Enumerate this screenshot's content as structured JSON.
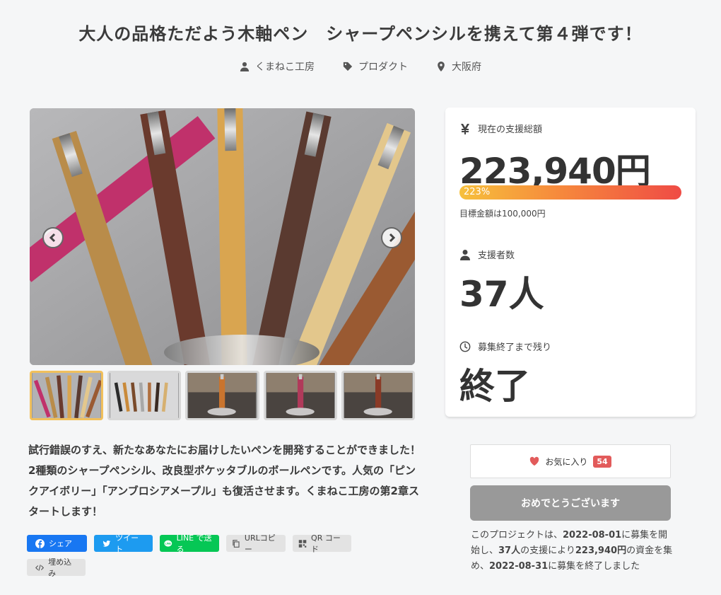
{
  "project": {
    "title": "大人の品格ただよう木軸ペン　シャープペンシルを携えて第４弾です！",
    "meta": [
      {
        "icon": "user-icon",
        "label": "くまねこ工房"
      },
      {
        "icon": "tag-icon",
        "label": "プロダクト"
      },
      {
        "icon": "location-pin-icon",
        "label": "大阪府"
      }
    ]
  },
  "stats": {
    "amount_label": "現在の支援総額",
    "amount_value": "223,940円",
    "progress_text": "223%",
    "progress_percent": 223,
    "goal_text": "目標金額は100,000円",
    "backers_label": "支援者数",
    "backers_value": "37人",
    "remaining_label": "募集終了まで残り",
    "remaining_value": "終了"
  },
  "description": "試行錯誤のすえ、新たなあなたにお届けしたいペンを開発することができました！2種類のシャープペンシル、改良型ポケッタブルのボールペンです。人気の「ピンクアイボリー」「アンブロシアメープル」も復活させます。くまねこ工房の第2章スタートします！",
  "share": {
    "facebook": "シェア",
    "twitter": "ツイート",
    "line": "LINE で送る",
    "url_copy": "URLコピー",
    "qr": "QR コード",
    "embed": "埋め込み"
  },
  "favorite": {
    "label": "お気に入り",
    "count": "54"
  },
  "status_button": "おめでとうございます",
  "summary": {
    "prefix": "このプロジェクトは、",
    "start_date": "2022-08-01",
    "mid1": "に募集を開始し、",
    "backers": "37人",
    "mid2": "の支援により",
    "amount": "223,940円",
    "mid3": "の資金を集め、",
    "end_date": "2022-08-31",
    "suffix": "に募集を終了しました"
  },
  "colors": {
    "progress_start": "#f6c03c",
    "progress_end": "#ef4b45",
    "favorite_red": "#e25b5b",
    "done_gray": "#999999"
  }
}
